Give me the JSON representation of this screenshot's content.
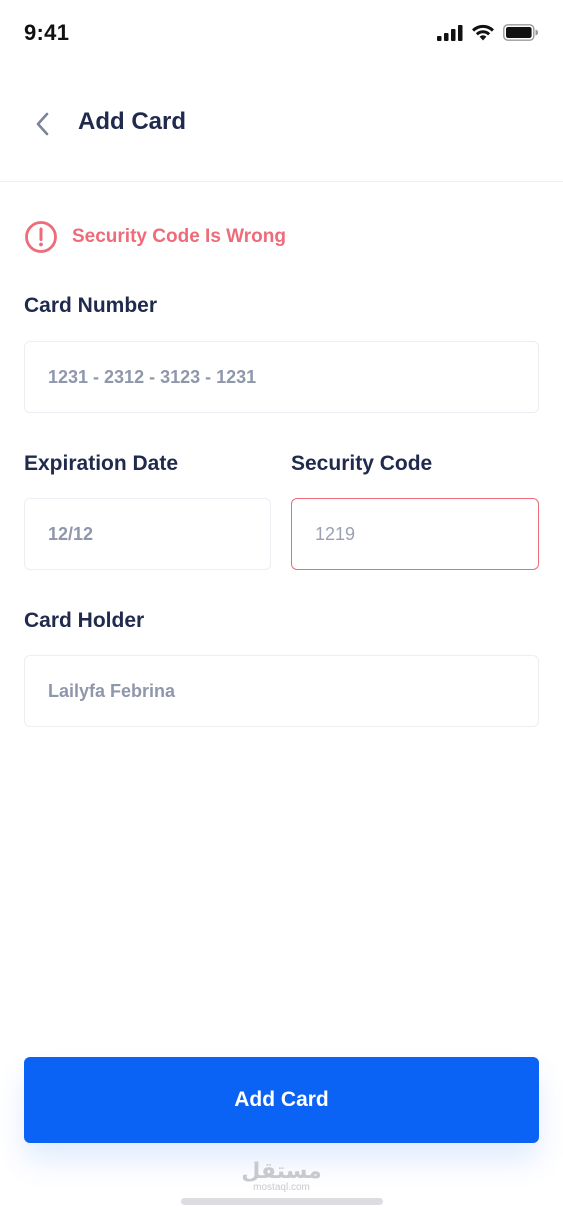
{
  "status_bar": {
    "time": "9:41"
  },
  "header": {
    "title": "Add Card"
  },
  "error": {
    "message": "Security Code Is Wrong",
    "color": "#ee6b7a"
  },
  "form": {
    "card_number": {
      "label": "Card Number",
      "value": "1231 - 2312 - 3123 - 1231"
    },
    "expiration_date": {
      "label": "Expiration Date",
      "value": "12/12"
    },
    "security_code": {
      "label": "Security Code",
      "value": "1219"
    },
    "card_holder": {
      "label": "Card Holder",
      "value": "Lailyfa Febrina"
    }
  },
  "submit_button": {
    "label": "Add Card",
    "color": "#0b63f6"
  },
  "watermark": {
    "logo": "مستقل",
    "url": "mostaql.com"
  }
}
